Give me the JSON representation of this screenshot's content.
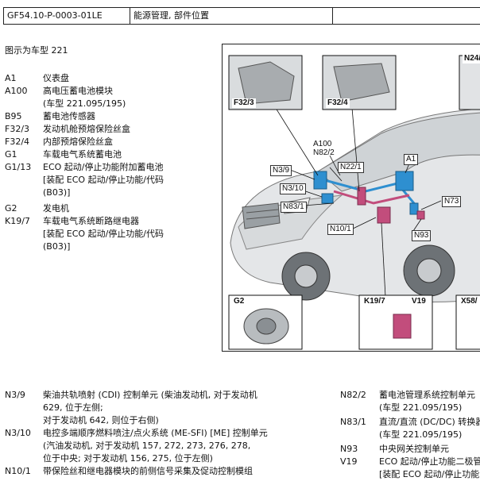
{
  "header": {
    "doc_id": "GF54.10-P-0003-01LE",
    "title": "能源管理, 部件位置",
    "blank": ""
  },
  "intro": "图示为车型 221",
  "legend": [
    {
      "code": "A1",
      "desc": "仪表盘"
    },
    {
      "code": "A100",
      "desc": "高电压蓄电池模块\n(车型 221.095/195)"
    },
    {
      "code": "B95",
      "desc": "蓄电池传感器"
    },
    {
      "code": "F32/3",
      "desc": "发动机舱预熔保险丝盒"
    },
    {
      "code": "F32/4",
      "desc": "内部预熔保险丝盒"
    },
    {
      "code": "G1",
      "desc": "车载电气系统蓄电池"
    },
    {
      "code": "G1/13",
      "desc": "ECO 起动/停止功能附加蓄电池\n[装配 ECO 起动/停止功能/代码\n(B03)]"
    },
    {
      "code": "G2",
      "desc": "发电机"
    },
    {
      "code": "K19/7",
      "desc": "车载电气系统断路继电器\n[装配 ECO 起动/停止功能/代码\n(B03)]"
    }
  ],
  "figure": {
    "labels": {
      "f32_3": "F32/3",
      "f32_4": "F32/4",
      "n24": "N24/",
      "a100": "A100",
      "n82_2": "N82/2",
      "a1": "A1",
      "n3_9": "N3/9",
      "n22_1": "N22/1",
      "n3_10": "N3/10",
      "n73": "N73",
      "n83_1": "N83/1",
      "n10_1": "N10/1",
      "n93": "N93",
      "g2": "G2",
      "k19_7": "K19/7",
      "v19": "V19",
      "x58": "X58/"
    }
  },
  "bottom_left": [
    {
      "code": "N3/9",
      "desc": "柴油共轨喷射 (CDI) 控制单元 (柴油发动机, 对于发动机\n629, 位于左侧;\n对于发动机 642, 则位于右侧)"
    },
    {
      "code": "N3/10",
      "desc": "电控多端顺序燃料喷注/点火系统 (ME-SFI) [ME] 控制单元\n(汽油发动机, 对于发动机 157, 272, 273, 276, 278,\n位于中央; 对于发动机 156, 275, 位于左侧)"
    },
    {
      "code": "N10/1",
      "desc": "带保险丝和继电器模块的前侧信号采集及促动控制模组"
    }
  ],
  "bottom_right": [
    {
      "code": "N82/2",
      "desc": "蓄电池管理系统控制单元\n(车型 221.095/195)"
    },
    {
      "code": "N83/1",
      "desc": "直流/直流 (DC/DC) 转换器\n(车型 221.095/195)"
    },
    {
      "code": "N93",
      "desc": "中央网关控制单元"
    },
    {
      "code": "V19",
      "desc": "ECO 起动/停止功能二极管\n[装配 ECO 起动/停止功能"
    }
  ]
}
